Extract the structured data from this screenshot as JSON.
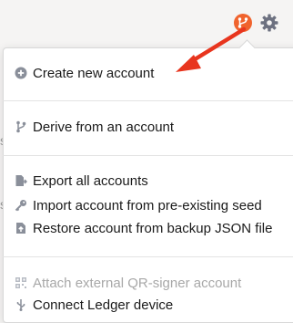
{
  "menu": {
    "groups": [
      [
        {
          "label": "Create new account",
          "icon": "plus-circle-icon",
          "disabled": false
        }
      ],
      [
        {
          "label": "Derive from an account",
          "icon": "code-branch-icon",
          "disabled": false
        }
      ],
      [
        {
          "label": "Export all accounts",
          "icon": "file-export-icon",
          "disabled": false
        },
        {
          "label": "Import account from pre-existing seed",
          "icon": "key-icon",
          "disabled": false
        },
        {
          "label": "Restore account from backup JSON file",
          "icon": "file-upload-icon",
          "disabled": false
        }
      ],
      [
        {
          "label": "Attach external QR-signer account",
          "icon": "qrcode-icon",
          "disabled": true
        },
        {
          "label": "Connect Ledger device",
          "icon": "usb-icon",
          "disabled": false
        }
      ]
    ]
  },
  "colors": {
    "accent": "#f0632d",
    "settings": "#6d7180",
    "arrow": "#e8351e"
  }
}
